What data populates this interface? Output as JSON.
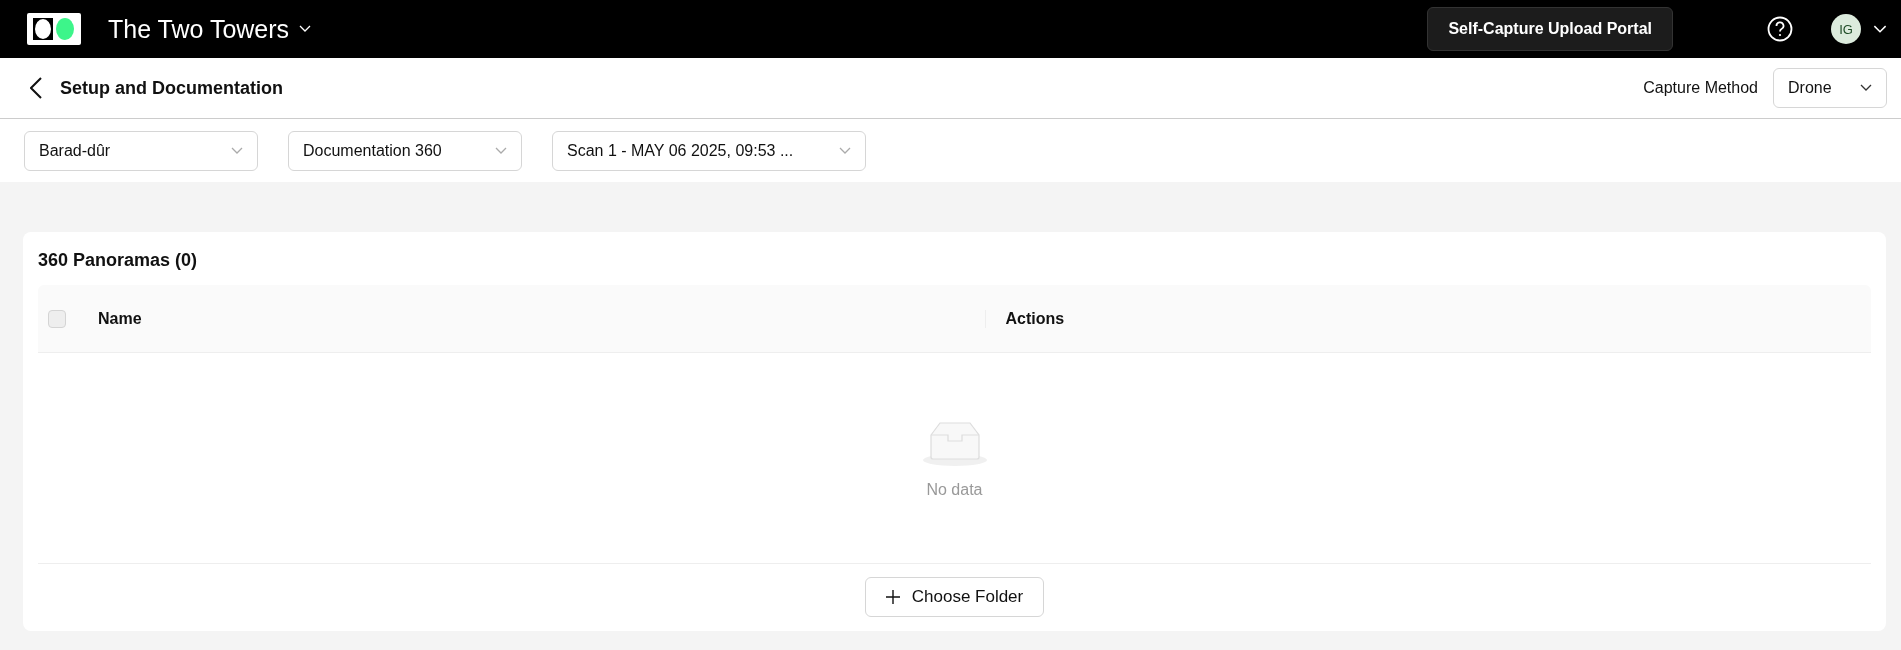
{
  "top_bar": {
    "project": "The Two Towers",
    "portal_button": "Self-Capture Upload Portal",
    "avatar": "IG"
  },
  "header": {
    "title": "Setup and Documentation",
    "capture_method_label": "Capture Method",
    "capture_method": "Drone"
  },
  "filters": [
    "Barad-dûr",
    "Documentation 360",
    "Scan 1 - MAY 06 2025, 09:53 ..."
  ],
  "panel": {
    "title": "360 Panoramas (0)",
    "select_all_checked": false,
    "columns": [
      "Name",
      "Actions"
    ],
    "empty_text": "No data",
    "button": "Choose Folder"
  }
}
